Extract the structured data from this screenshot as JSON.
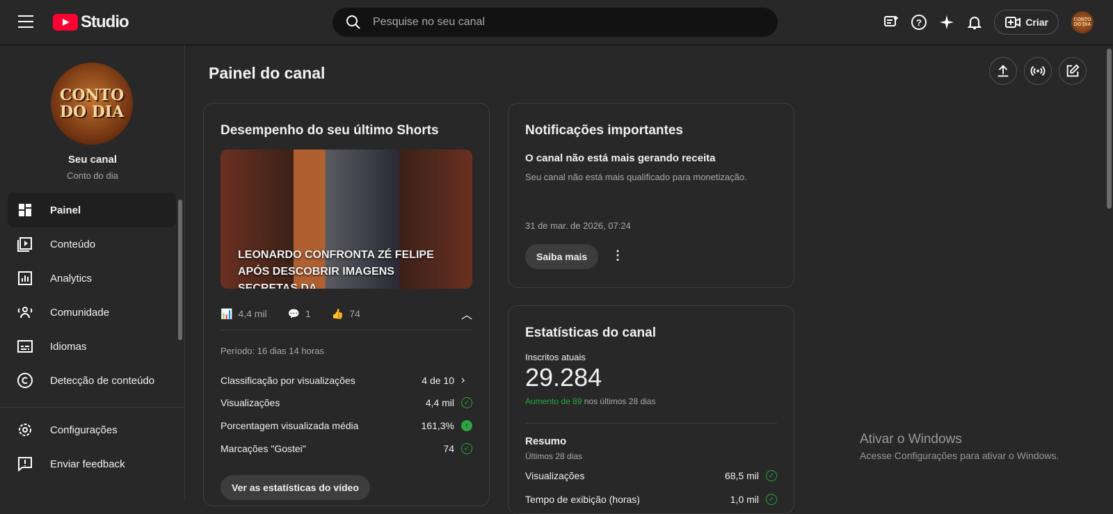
{
  "header": {
    "logo_text": "Studio",
    "search_placeholder": "Pesquise no seu canal",
    "create_label": "Criar",
    "avatar_text": "CONTO DO DIA"
  },
  "sidebar": {
    "channel_title": "Seu canal",
    "channel_name": "Conto do dia",
    "avatar_text": "CONTO DO DIA",
    "items": [
      {
        "label": "Painel"
      },
      {
        "label": "Conteúdo"
      },
      {
        "label": "Analytics"
      },
      {
        "label": "Comunidade"
      },
      {
        "label": "Idiomas"
      },
      {
        "label": "Detecção de conteúdo"
      },
      {
        "label": "Configurações"
      },
      {
        "label": "Enviar feedback"
      }
    ]
  },
  "page_title": "Painel do canal",
  "shorts": {
    "title": "Desempenho do seu último Shorts",
    "video_title": "LEONARDO CONFRONTA ZÉ FELIPE APÓS DESCOBRIR IMAGENS SECRETAS DA...",
    "views": "4,4 mil",
    "comments": "1",
    "likes": "74",
    "period": "Período: 16 dias 14 horas",
    "rows": [
      {
        "label": "Classificação por visualizações",
        "value": "4 de 10"
      },
      {
        "label": "Visualizações",
        "value": "4,4 mil"
      },
      {
        "label": "Porcentagem visualizada média",
        "value": "161,3%"
      },
      {
        "label": "Marcações \"Gostei\"",
        "value": "74"
      }
    ],
    "button": "Ver as estatísticas do vídeo"
  },
  "notifications": {
    "title": "Notificações importantes",
    "heading": "O canal não está mais gerando receita",
    "body": "Seu canal não está mais qualificado para monetização.",
    "date": "31 de mar. de 2026, 07:24",
    "button": "Saiba mais"
  },
  "stats": {
    "title": "Estatísticas do canal",
    "subs_label": "Inscritos atuais",
    "subs": "29.284",
    "increase": "Aumento de 89",
    "increase_suffix": " nos últimos 28 dias",
    "summary_title": "Resumo",
    "summary_period": "Últimos 28 dias",
    "rows": [
      {
        "label": "Visualizações",
        "value": "68,5 mil"
      },
      {
        "label": "Tempo de exibição (horas)",
        "value": "1,0 mil"
      }
    ]
  },
  "watermark": {
    "title": "Ativar o Windows",
    "body": "Acesse Configurações para ativar o Windows."
  },
  "colors": {
    "bg": "#282828",
    "green": "#2ba640",
    "brand": "#ff0033"
  }
}
